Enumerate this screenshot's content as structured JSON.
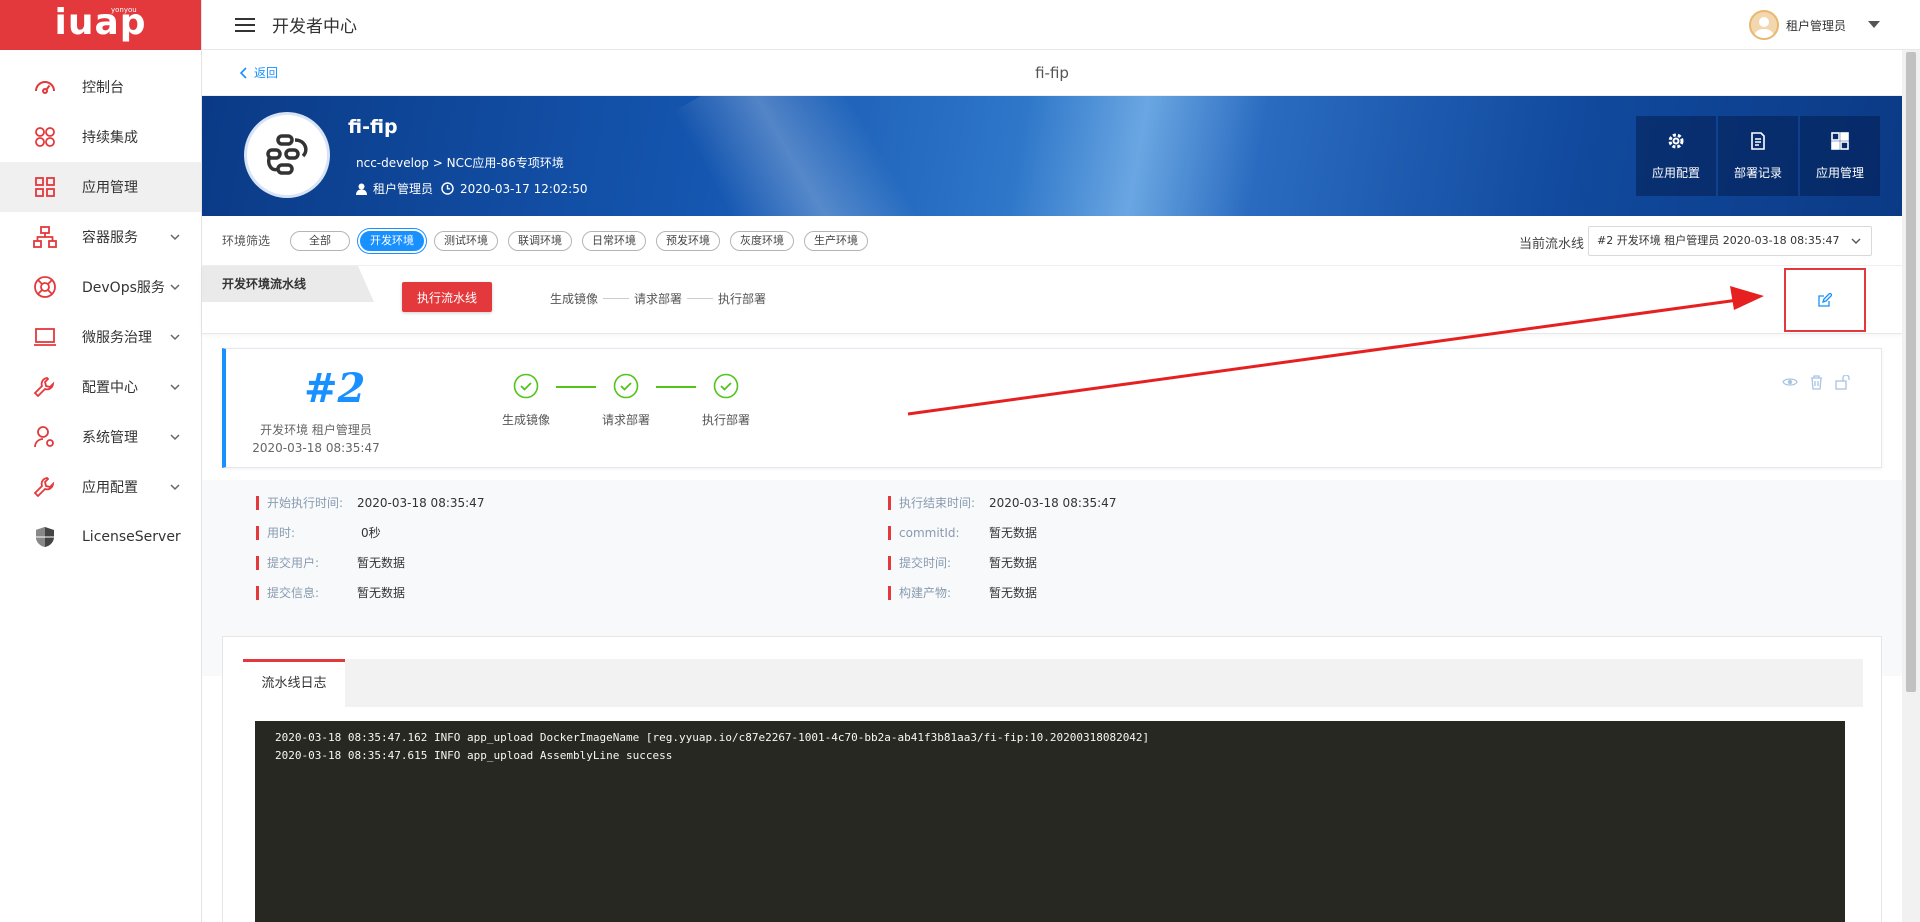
{
  "sidebar": {
    "logo_text": "iuap",
    "logo_sub": "yonyou",
    "items": [
      {
        "label": "控制台"
      },
      {
        "label": "持续集成"
      },
      {
        "label": "应用管理"
      },
      {
        "label": "容器服务"
      },
      {
        "label": "DevOps服务"
      },
      {
        "label": "微服务治理"
      },
      {
        "label": "配置中心"
      },
      {
        "label": "系统管理"
      },
      {
        "label": "应用配置"
      },
      {
        "label": "LicenseServer"
      }
    ]
  },
  "topbar": {
    "title": "开发者中心",
    "user": "租户管理员"
  },
  "page": {
    "back_label": "返回",
    "title": "fi-fip"
  },
  "app": {
    "name": "fi-fip",
    "breadcrumb": "ncc-develop  >  NCC应用-86专项环境",
    "owner": "租户管理员",
    "created": "2020-03-17 12:02:50",
    "actions": [
      {
        "label": "应用配置",
        "icon": "gear-icon"
      },
      {
        "label": "部署记录",
        "icon": "document-icon"
      },
      {
        "label": "应用管理",
        "icon": "grid-icon"
      }
    ]
  },
  "env_filter": {
    "label": "环境筛选",
    "chips": [
      "全部",
      "开发环境",
      "测试环境",
      "联调环境",
      "日常环境",
      "预发环境",
      "灰度环境",
      "生产环境"
    ],
    "active": "开发环境",
    "current_label": "当前流水线",
    "current_value": "#2 开发环境 租户管理员 2020-03-18 08:35:47"
  },
  "pipeline": {
    "tab_label": "开发环境流水线",
    "run_button": "执行流水线",
    "steps": [
      "生成镜像",
      "请求部署",
      "执行部署"
    ]
  },
  "run": {
    "number": "#2",
    "env_user": "开发环境 租户管理员",
    "time": "2020-03-18 08:35:47",
    "stages": [
      "生成镜像",
      "请求部署",
      "执行部署"
    ],
    "status_color": "#52c41a"
  },
  "details": {
    "left": [
      {
        "key": "开始执行时间:",
        "value": "2020-03-18 08:35:47"
      },
      {
        "key": "用时:",
        "value": "0秒"
      },
      {
        "key": "提交用户:",
        "value": "暂无数据"
      },
      {
        "key": "提交信息:",
        "value": "暂无数据"
      }
    ],
    "right": [
      {
        "key": "执行结束时间:",
        "value": "2020-03-18 08:35:47"
      },
      {
        "key": "commitId:",
        "value": "暂无数据"
      },
      {
        "key": "提交时间:",
        "value": "暂无数据"
      },
      {
        "key": "构建产物:",
        "value": "暂无数据"
      }
    ]
  },
  "log": {
    "tab_label": "流水线日志",
    "lines": [
      "2020-03-18 08:35:47.162 INFO app_upload DockerImageName [reg.yyuap.io/c87e2267-1001-4c70-bb2a-ab41f3b81aa3/fi-fip:10.20200318082042]",
      "2020-03-18 08:35:47.615 INFO app_upload AssemblyLine success"
    ]
  },
  "colors": {
    "brand_red": "#e4393c",
    "primary_blue": "#1890ff",
    "success_green": "#52c41a"
  }
}
